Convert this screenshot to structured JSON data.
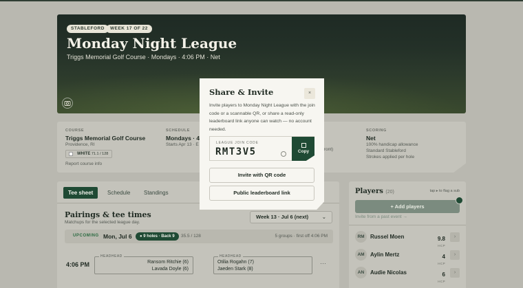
{
  "hero": {
    "tag_format": "STABLEFORD",
    "tag_week": "WEEK 17 OF 22",
    "title": "Monday Night League",
    "subtitle": "Triggs Memorial Golf Course · Mondays · 4:06 PM · Net"
  },
  "info": {
    "course_label": "COURSE",
    "course_name": "Triggs Memorial Golf Course",
    "course_location": "Providence, RI",
    "tee_name": "WHITE",
    "tee_rating": "71.1 / 128",
    "report_link": "Report course info",
    "schedule_label": "SCHEDULE",
    "schedule_value": "Mondays · 4:",
    "schedule_sub": "Starts Apr 13 · E",
    "middle_partial": "front)",
    "scoring_label": "SCORING",
    "scoring_value": "Net",
    "scoring_lines": [
      "100% handicap allowance",
      "Standard Stableford",
      "Strokes applied per hole"
    ]
  },
  "tabs": [
    "Tee sheet",
    "Schedule",
    "Standings"
  ],
  "pairings": {
    "title": "Pairings & tee times",
    "subtitle": "Matchups for the selected league day.",
    "week_select": "Week 13 · Jul 6 (next)",
    "day_status": "UPCOMING",
    "day": "Mon, Jul 6",
    "holes_badge": "9 holes · Back 9",
    "rating": "35.5 / 128",
    "groups": "5 groups · first off 4:06 PM",
    "tee_time": "4:06 PM",
    "match_label": "HEADHEAD",
    "left_players": [
      "Ransom Ritchie (6)",
      "Lavada Doyle (6)"
    ],
    "right_players": [
      "Otilia Rogahn (7)",
      "Jaeden Stark (8)"
    ]
  },
  "players": {
    "title": "Players",
    "count": "(20)",
    "hint": "tap ▸ to flag a sub",
    "add_button": "+ Add players",
    "past_event_link": "Invite from a past event →",
    "hcp_unit": "HCP",
    "list": [
      {
        "initials": "RM",
        "name": "Russel Moen",
        "hcp": "9.8"
      },
      {
        "initials": "AM",
        "name": "Aylin Mertz",
        "hcp": "4"
      },
      {
        "initials": "AN",
        "name": "Audie Nicolas",
        "hcp": "6"
      }
    ]
  },
  "modal": {
    "title": "Share & Invite",
    "close": "×",
    "description": "Invite players to Monday Night League with the join code or a scannable QR, or share a read-only leaderboard link anyone can watch — no account needed.",
    "code_label": "LEAGUE JOIN CODE",
    "code": "RMT3V5",
    "copy_label": "Copy",
    "qr_button": "Invite with QR code",
    "leaderboard_button": "Public leaderboard link"
  }
}
